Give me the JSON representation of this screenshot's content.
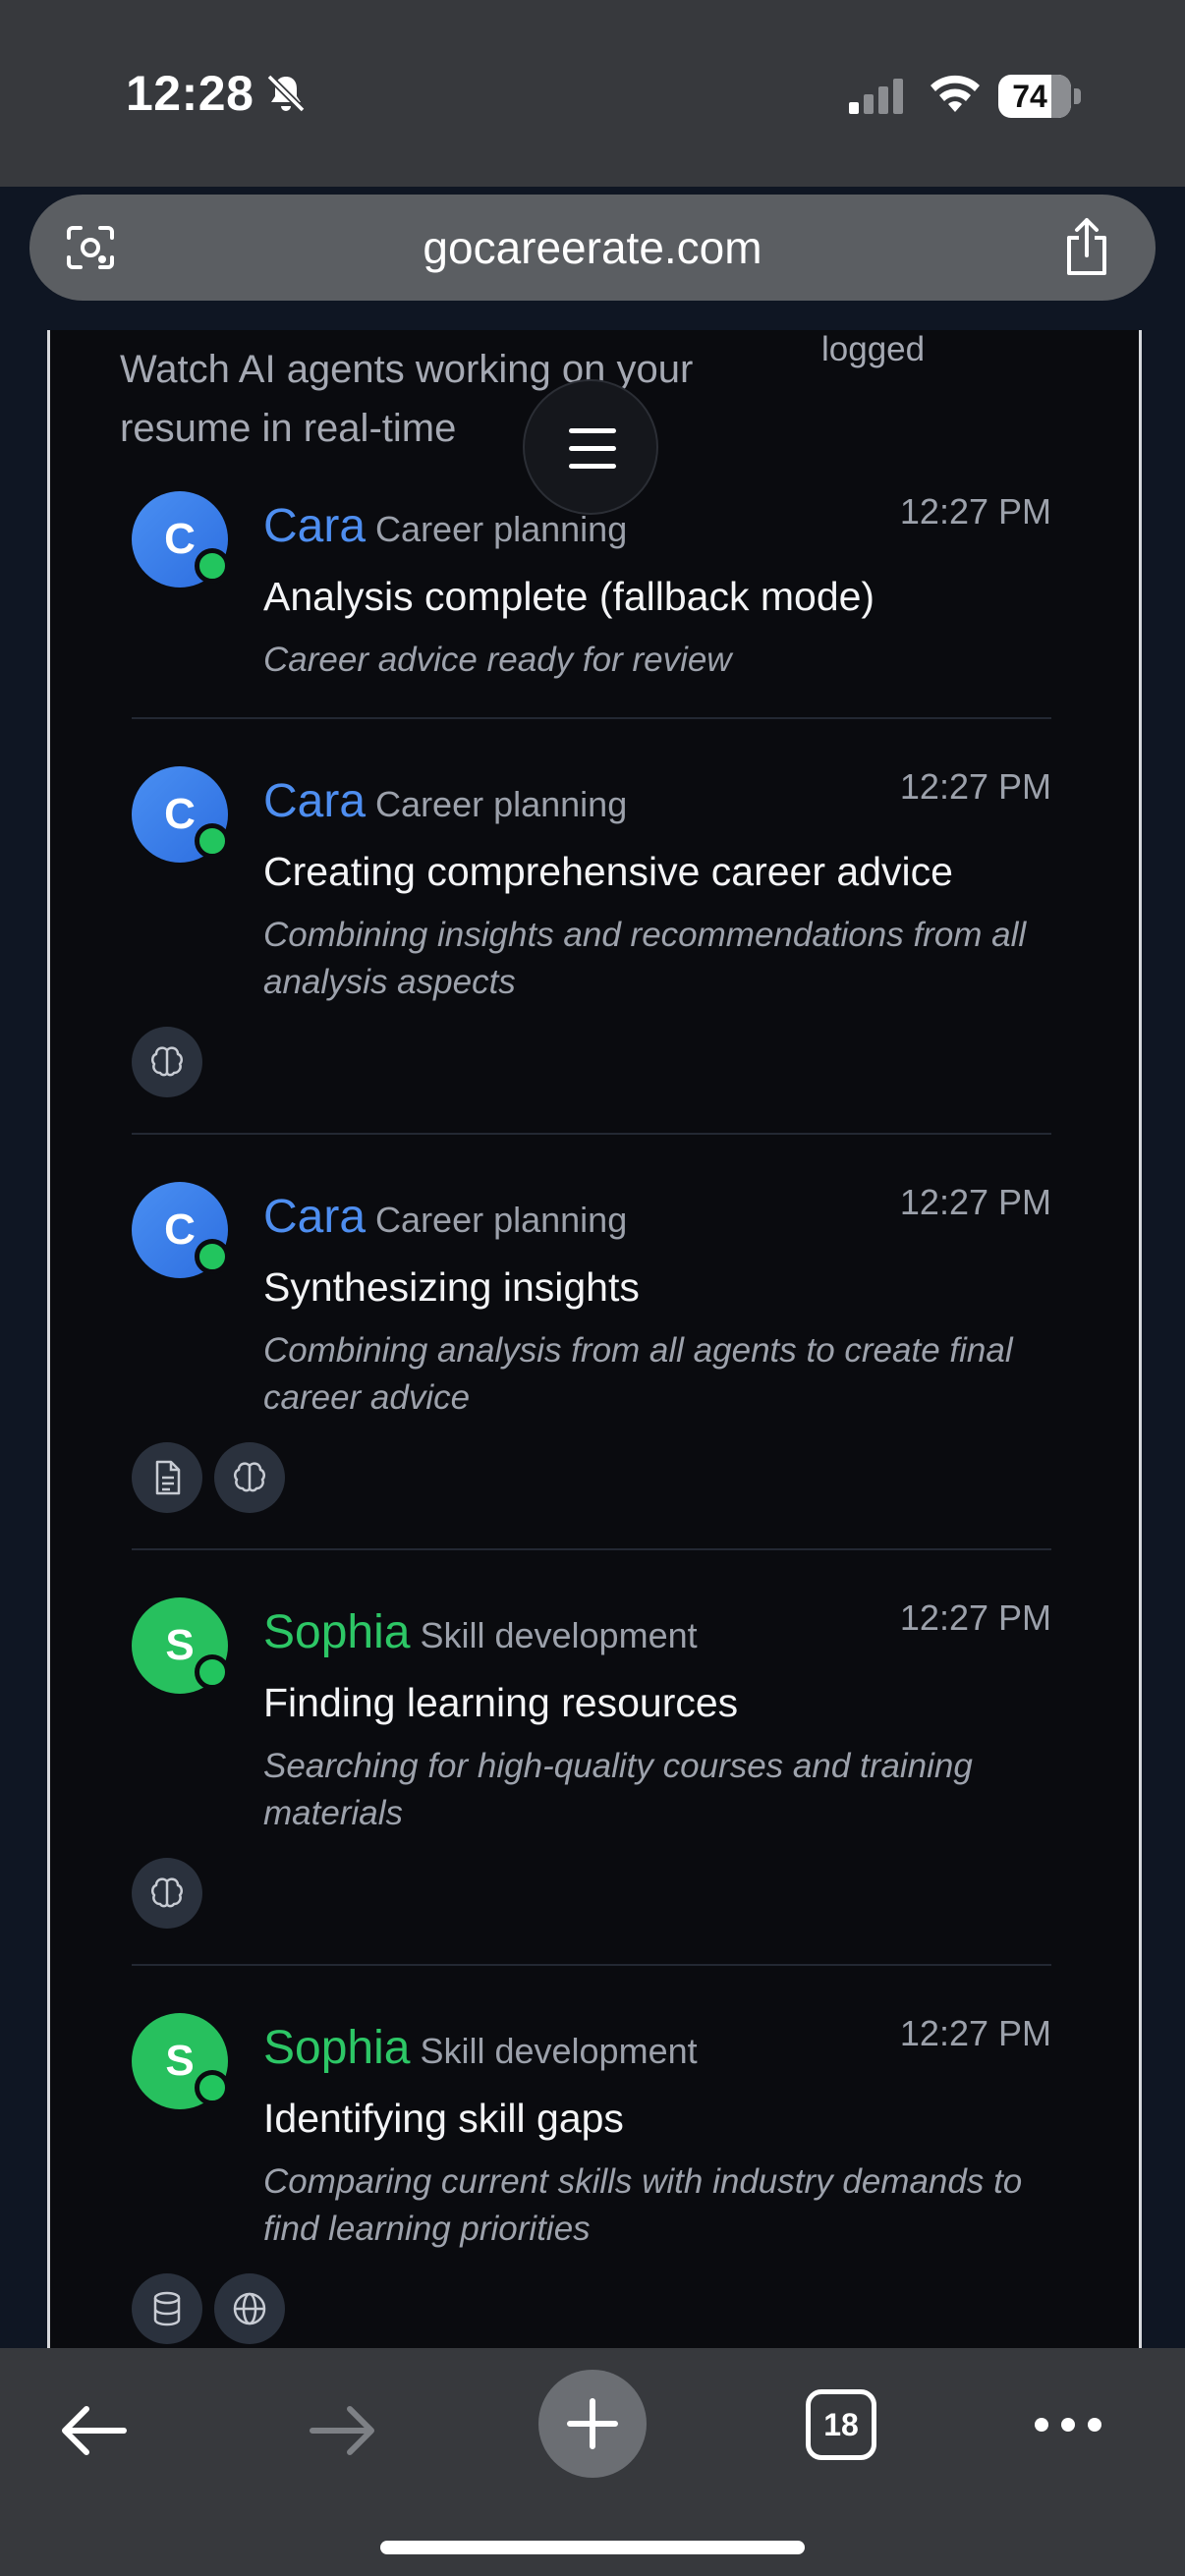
{
  "status_bar": {
    "time": "12:28",
    "battery": "74"
  },
  "browser": {
    "url": "gocareerate.com",
    "tab_count": "18"
  },
  "header": {
    "subtitle": "Watch AI agents working on your resume in real-time",
    "logged_label": "logged"
  },
  "entries": [
    {
      "initial": "C",
      "name": "Cara",
      "role": "Career planning",
      "time": "12:27 PM",
      "title": "Analysis complete (fallback mode)",
      "description": "Career advice ready for review",
      "color": "#4e8ef0",
      "chips": []
    },
    {
      "initial": "C",
      "name": "Cara",
      "role": "Career planning",
      "time": "12:27 PM",
      "title": "Creating comprehensive career advice",
      "description": "Combining insights and recommendations from all analysis aspects",
      "color": "#4e8ef0",
      "chips": [
        "brain-icon"
      ]
    },
    {
      "initial": "C",
      "name": "Cara",
      "role": "Career planning",
      "time": "12:27 PM",
      "title": "Synthesizing insights",
      "description": "Combining analysis from all agents to create final career advice",
      "color": "#4e8ef0",
      "chips": [
        "document-icon",
        "brain-icon"
      ]
    },
    {
      "initial": "S",
      "name": "Sophia",
      "role": "Skill development",
      "time": "12:27 PM",
      "title": "Finding learning resources",
      "description": "Searching for high-quality courses and training materials",
      "color": "#2dc766",
      "chips": [
        "brain-icon"
      ]
    },
    {
      "initial": "S",
      "name": "Sophia",
      "role": "Skill development",
      "time": "12:27 PM",
      "title": "Identifying skill gaps",
      "description": "Comparing current skills with industry demands to find learning priorities",
      "color": "#2dc766",
      "chips": [
        "database-icon",
        "globe-icon"
      ]
    }
  ]
}
